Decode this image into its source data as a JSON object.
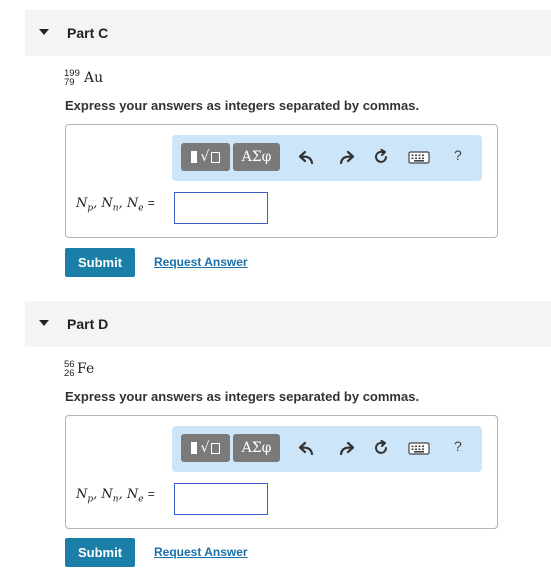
{
  "partC": {
    "title": "Part C",
    "mass_number": "199",
    "atomic_number": "79",
    "symbol": "Au",
    "instruction": "Express your answers as integers separated by commas.",
    "toolbar": {
      "greek_label": "ΑΣφ",
      "help_label": "?"
    },
    "answer_value": "",
    "submit_label": "Submit",
    "request_label": "Request Answer"
  },
  "partD": {
    "title": "Part D",
    "mass_number": "56",
    "atomic_number": "26",
    "symbol": "Fe",
    "instruction": "Express your answers as integers separated by commas.",
    "toolbar": {
      "greek_label": "ΑΣφ",
      "help_label": "?"
    },
    "answer_value": "",
    "submit_label": "Submit",
    "request_label": "Request Answer"
  },
  "variables": {
    "np": "N",
    "p": "p",
    "nn": "N",
    "n": "n",
    "ne": "N",
    "e": "e",
    "equals": "="
  }
}
